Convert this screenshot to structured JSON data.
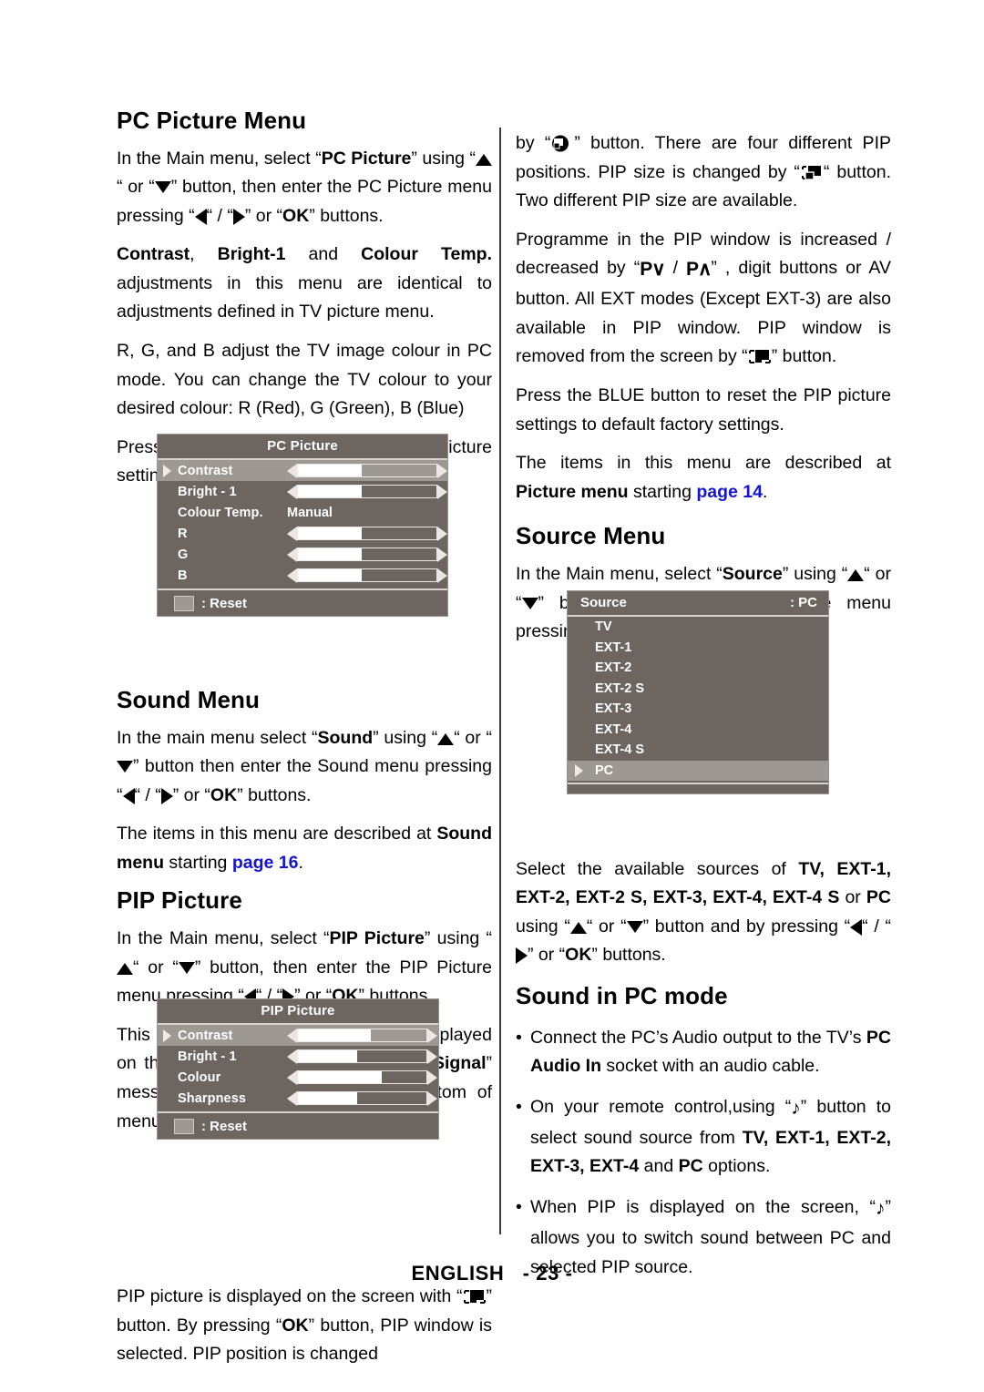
{
  "footer": {
    "language": "ENGLISH",
    "page_number": "- 23 -"
  },
  "left_column": {
    "heading_pc_picture": "PC Picture Menu",
    "p1_a": "In the Main menu, select “",
    "p1_b": "PC Picture",
    "p1_c": "” using “",
    "p1_d": "“ or “",
    "p1_e": "” button, then enter the PC Picture menu pressing “",
    "p1_f": "“ / “",
    "p1_g": "” or “",
    "p1_ok": "OK",
    "p1_h": "” buttons.",
    "p2_contrast": "Contrast",
    "p2_comma": ", ",
    "p2_bright": "Bright-1",
    "p2_and": " and ",
    "p2_colourtemp": "Colour Temp.",
    "p2_tail": " adjustments in this menu  are identical to adjustments defined in TV picture menu.",
    "p3": "R, G, and B adjust the TV image colour in PC mode. You can change the TV colour to your desired colour: R (Red), G (Green), B (Blue)",
    "p4": "Press the BLUE button to reset the PC picture settings to default factory settings.",
    "heading_sound": "Sound Menu",
    "sound_p1_a": "In the main menu select “",
    "sound_p1_b": "Sound",
    "sound_p1_c": "” using  “",
    "sound_p1_d": "“ or “",
    "sound_p1_e": "” button then enter the Sound menu pressing “",
    "sound_p1_f": "“ / “",
    "sound_p1_g": "” or “",
    "sound_p1_ok": "OK",
    "sound_p1_h": "” buttons.",
    "sound_p2_a": "The items in this menu are described at ",
    "sound_p2_b": "Sound menu",
    "sound_p2_c": " starting ",
    "sound_p2_link": "page 16",
    "sound_p2_d": ".",
    "heading_pip": "PIP Picture",
    "pip_p1_a": "In the Main menu, select “",
    "pip_p1_b": "PIP Picture",
    "pip_p1_c": "” using “",
    "pip_p1_d": "“ or “",
    "pip_p1_e": "” button, then enter the PIP Picture menu pressing “",
    "pip_p1_f": "“ / “",
    "pip_p1_g": "” or “",
    "pip_p1_ok": "OK",
    "pip_p1_h": "” buttons.",
    "pip_p2_a": "This menu is displayed when PIP is displayed on the screen and otherwise “",
    "pip_p2_b": "PIP No Signal",
    "pip_p2_c": "” message will be displayed at the bottom of menu.",
    "pip_p3_a": "PIP picture is displayed on the screen with “",
    "pip_p3_b": "” button. By pressing “",
    "pip_p3_ok": "OK",
    "pip_p3_c": "” button, PIP window is selected. PIP position is changed"
  },
  "right_column": {
    "p1_a": "by “",
    "p1_b": "” button. There are four different PIP positions. PIP size is changed by “",
    "p1_c": "“ button. Two different PIP size are available.",
    "p2_a": "Programme in the PIP window is increased / decreased by “",
    "p2_pdown": "P",
    "p2_slash": " / ",
    "p2_pup": "P",
    "p2_b": "” , digit buttons or AV button. All EXT modes (Except EXT-3) are also available in PIP window. PIP window is removed from the screen by “",
    "p2_c": "” button.",
    "p3": "Press the BLUE button to reset the PIP picture settings to default factory settings.",
    "p4_a": "The items in this menu are described at ",
    "p4_b": "Picture menu",
    "p4_c": " starting ",
    "p4_link": "page 14",
    "p4_d": ".",
    "heading_source": "Source Menu",
    "src_p1_a": "In the Main menu, select “",
    "src_p1_b": "Source",
    "src_p1_c": "” using “",
    "src_p1_d": "“ or “",
    "src_p1_e": "” button, then enter the Source menu pressing “",
    "src_p1_f": "“ / “",
    "src_p1_g": "” or “",
    "src_p1_ok": "OK",
    "src_p1_h": "” buttons.",
    "src_p2_a": "Select the available sources of ",
    "src_p2_b": "TV, EXT-1, EXT-2, EXT-2 S, EXT-3, EXT-4, EXT-4 S",
    "src_p2_c": " or ",
    "src_p2_pc": "PC",
    "src_p2_d": " using “",
    "src_p2_e": "“ or “",
    "src_p2_f": "” button and by pressing “",
    "src_p2_g": "“ / “",
    "src_p2_h": "” or “",
    "src_p2_ok": "OK",
    "src_p2_i": "” buttons.",
    "heading_sound_pc": "Sound in PC mode",
    "bullet1_a": "Connect the PC’s Audio output to the TV’s ",
    "bullet1_b": "PC Audio In",
    "bullet1_c": " socket with an audio cable.",
    "bullet2_a": " On your remote control,using “",
    "bullet2_b": "” button to select sound source from ",
    "bullet2_c": "TV, EXT-1, EXT-2, EXT-3, EXT-4",
    "bullet2_d": " and ",
    "bullet2_pc": "PC",
    "bullet2_e": " options.",
    "bullet3_a": "When PIP is displayed on the screen, “",
    "bullet3_b": "” allows you to switch sound between PC and selected PIP source."
  },
  "osd_pc_picture": {
    "title": "PC Picture",
    "rows": [
      {
        "label": "Contrast",
        "type": "slider",
        "fill": 46,
        "selected": true
      },
      {
        "label": "Bright - 1",
        "type": "slider",
        "fill": 46,
        "selected": false
      },
      {
        "label": "Colour Temp.",
        "type": "value",
        "value": "Manual",
        "selected": false
      },
      {
        "label": "R",
        "type": "slider",
        "fill": 46,
        "selected": false
      },
      {
        "label": "G",
        "type": "slider",
        "fill": 46,
        "selected": false
      },
      {
        "label": "B",
        "type": "slider",
        "fill": 46,
        "selected": false
      }
    ],
    "footer_label": ": Reset"
  },
  "osd_pip_picture": {
    "title": "PIP Picture",
    "rows": [
      {
        "label": "Contrast",
        "type": "slider",
        "fill": 57,
        "selected": true
      },
      {
        "label": "Bright - 1",
        "type": "slider",
        "fill": 46,
        "selected": false
      },
      {
        "label": "Colour",
        "type": "slider",
        "fill": 65,
        "selected": false
      },
      {
        "label": "Sharpness",
        "type": "slider",
        "fill": 46,
        "selected": false
      }
    ],
    "footer_label": ": Reset"
  },
  "osd_source": {
    "title": "Source",
    "current_value": ": PC",
    "items": [
      {
        "label": "TV",
        "selected": false
      },
      {
        "label": "EXT-1",
        "selected": false
      },
      {
        "label": "EXT-2",
        "selected": false
      },
      {
        "label": "EXT-2 S",
        "selected": false
      },
      {
        "label": "EXT-3",
        "selected": false
      },
      {
        "label": "EXT-4",
        "selected": false
      },
      {
        "label": "EXT-4 S",
        "selected": false
      },
      {
        "label": "PC",
        "selected": true
      }
    ]
  },
  "colors": {
    "osd_bg": "#6d6560",
    "osd_highlight": "#9d9892",
    "osd_border": "#d8d2cc",
    "link_blue": "#1414d2"
  }
}
